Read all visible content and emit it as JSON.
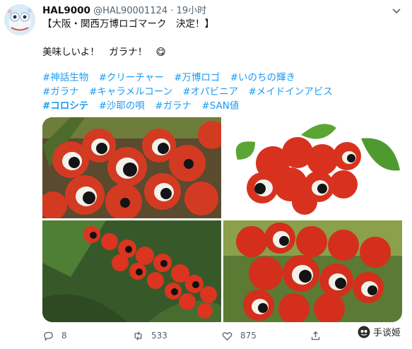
{
  "tweet": {
    "display_name": "HAL9000",
    "handle": "@HAL90001124",
    "time": "19小时",
    "line1": "【大阪・関西万博ロゴマーク　決定！】",
    "line2": "美味しいよ！　ガラナ！",
    "line2_emoji": "😋",
    "hashtag_rows": [
      [
        "#神話生物",
        "#クリーチャー",
        "#万博ロゴ",
        "#いのちの輝き"
      ],
      [
        "#ガラナ",
        "#キャラメルコーン",
        "#オパビニア",
        "#メイドインアビス"
      ],
      [
        "#コロシテ",
        "#沙耶の唄",
        "#ガラナ",
        "#SAN値"
      ]
    ]
  },
  "actions": {
    "reply_count": "8",
    "retweet_count": "533",
    "like_count": "875"
  },
  "watermark": {
    "text": "手谈姬"
  },
  "colors": {
    "link": "#1d9bf0",
    "muted": "#536471",
    "fruit_red": "#d8321e",
    "leaf_green": "#3f7d2b"
  }
}
